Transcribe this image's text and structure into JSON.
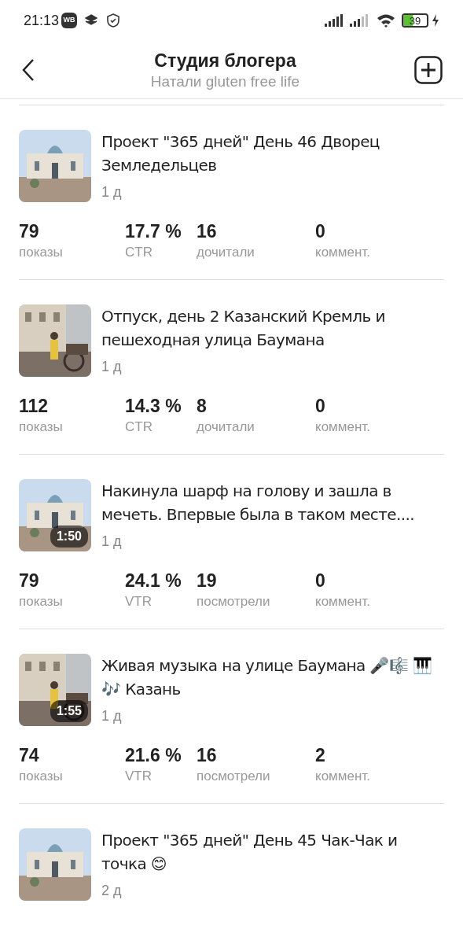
{
  "status_bar": {
    "time": "21:13",
    "app_badge": "WB",
    "battery": "39"
  },
  "header": {
    "title": "Студия блогера",
    "subtitle": "Натали gluten free life"
  },
  "posts": [
    {
      "kind": "article",
      "title": "Проект \"365 дней\" День 46 Дворец Земледельцев",
      "age": "1 д",
      "stats": [
        {
          "value": "79",
          "label": "показы"
        },
        {
          "value": "17.7 %",
          "label": "CTR"
        },
        {
          "value": "16",
          "label": "дочитали"
        },
        {
          "value": "0",
          "label": "коммент."
        }
      ]
    },
    {
      "kind": "article",
      "title": "Отпуск, день 2 Казанский Кремль и пешеходная улица Баумана",
      "age": "1 д",
      "stats": [
        {
          "value": "112",
          "label": "показы"
        },
        {
          "value": "14.3 %",
          "label": "CTR"
        },
        {
          "value": "8",
          "label": "дочитали"
        },
        {
          "value": "0",
          "label": "коммент."
        }
      ]
    },
    {
      "kind": "video",
      "duration": "1:50",
      "title": "Накинула шарф на голову и зашла в мечеть. Впервые была в таком месте....",
      "age": "1 д",
      "stats": [
        {
          "value": "79",
          "label": "показы"
        },
        {
          "value": "24.1 %",
          "label": "VTR"
        },
        {
          "value": "19",
          "label": "посмотрели"
        },
        {
          "value": "0",
          "label": "коммент."
        }
      ]
    },
    {
      "kind": "video",
      "duration": "1:55",
      "title": "Живая музыка на улице Баумана 🎤🎼 🎹🎶 Казань",
      "age": "1 д",
      "stats": [
        {
          "value": "74",
          "label": "показы"
        },
        {
          "value": "21.6 %",
          "label": "VTR"
        },
        {
          "value": "16",
          "label": "посмотрели"
        },
        {
          "value": "2",
          "label": "коммент."
        }
      ]
    },
    {
      "kind": "article",
      "title": "Проект \"365 дней\" День 45 Чак-Чак и точка 😊",
      "age": "2 д"
    }
  ]
}
